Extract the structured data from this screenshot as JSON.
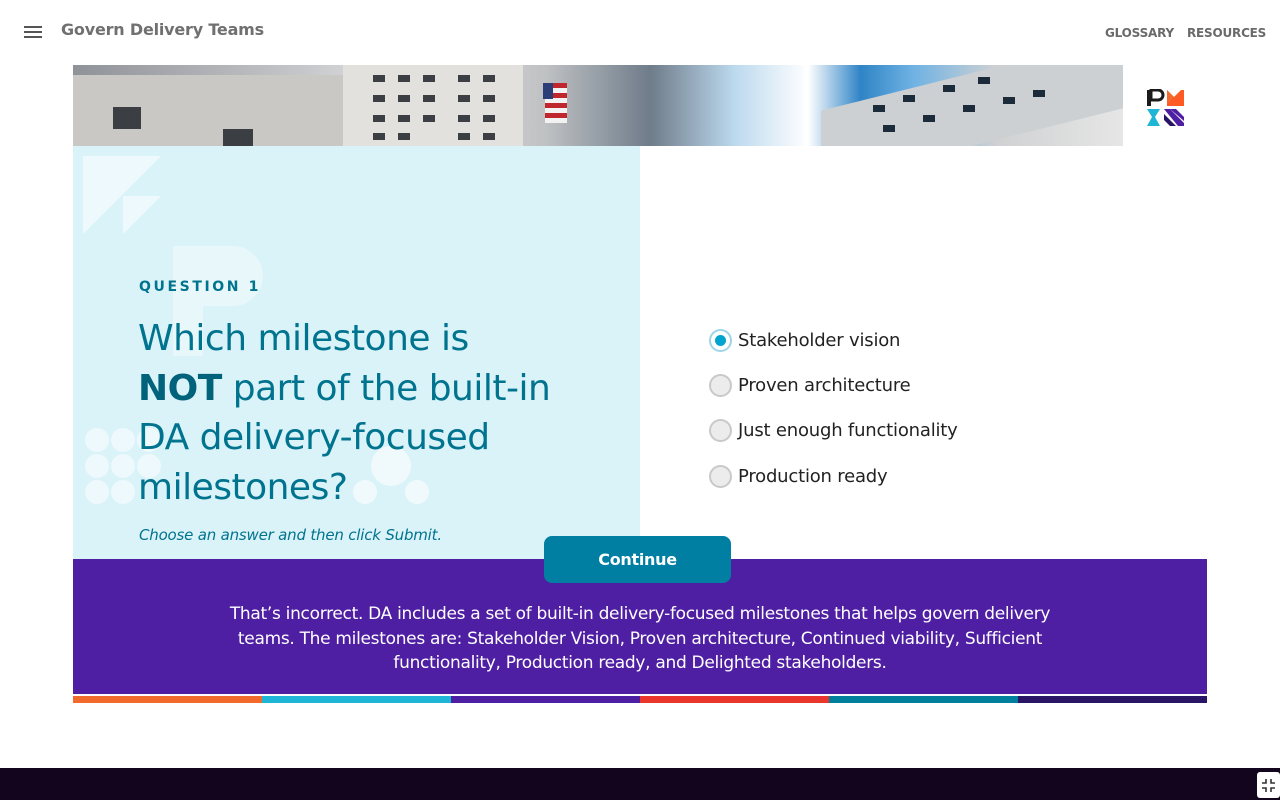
{
  "header": {
    "title": "Govern Delivery Teams",
    "nav": {
      "glossary": "GLOSSARY",
      "resources": "RESOURCES"
    }
  },
  "question": {
    "label": "QUESTION 1",
    "text_before": "Which milestone is",
    "emphasis": "NOT",
    "text_after": "part of the built-in DA delivery-focused milestones?",
    "instruction": "Choose an answer and then click Submit."
  },
  "options": [
    {
      "label": "Stakeholder vision",
      "selected": true
    },
    {
      "label": "Proven architecture",
      "selected": false
    },
    {
      "label": "Just enough functionality",
      "selected": false
    },
    {
      "label": "Production ready",
      "selected": false
    }
  ],
  "continue_label": "Continue",
  "feedback": "That’s incorrect. DA includes a set of built-in delivery-focused milestones that helps govern delivery teams. The milestones are: Stakeholder Vision, Proven architecture, Continued viability, Sufficient functionality, Production ready, and Delighted stakeholders.",
  "colors": {
    "teal": "#00738f",
    "purple": "#4f1fa3",
    "stripes": [
      "#f26b2d",
      "#1fb5d6",
      "#4f1fa3",
      "#e8362d",
      "#00809c",
      "#2a1466"
    ]
  }
}
